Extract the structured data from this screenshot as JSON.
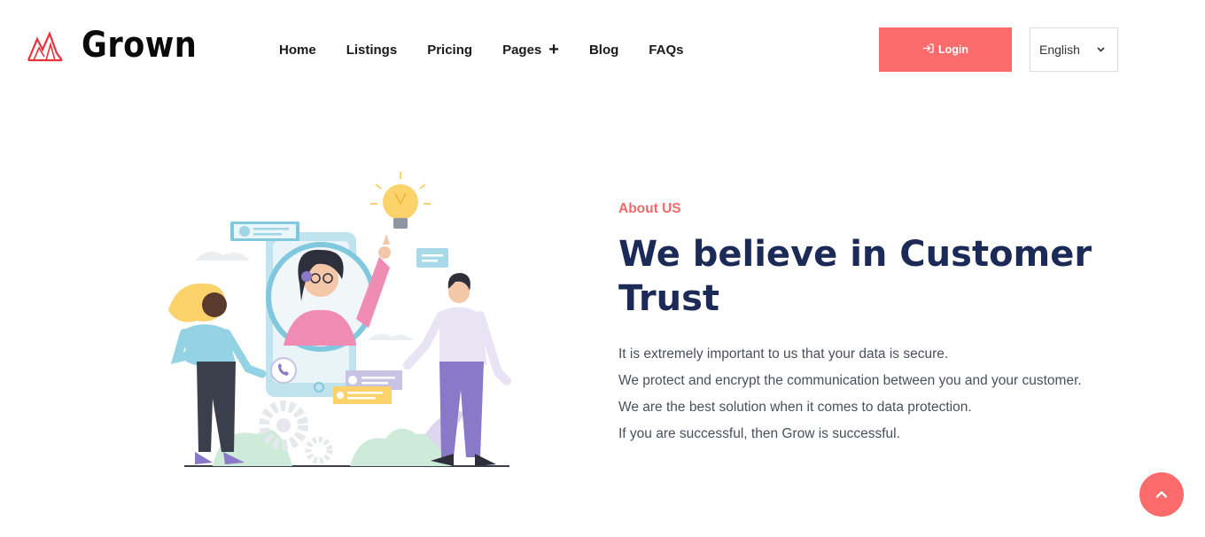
{
  "brand": {
    "name": "Grown"
  },
  "nav": {
    "items": [
      {
        "label": "Home"
      },
      {
        "label": "Listings"
      },
      {
        "label": "Pricing"
      },
      {
        "label": "Pages"
      },
      {
        "label": "Blog"
      },
      {
        "label": "FAQs"
      }
    ]
  },
  "header": {
    "login_label": "Login",
    "language": "English"
  },
  "about": {
    "eyebrow": "About US",
    "title": "We believe in Customer Trust",
    "paragraphs": [
      "It is extremely important to us that your data is secure.",
      "We protect and encrypt the communication between you and your customer.",
      "We are the best solution when it comes to data protection.",
      "If you are successful, then Grow is successful."
    ]
  },
  "colors": {
    "accent": "#fb6b6b",
    "heading": "#1c2a58",
    "eyebrow": "#f26a6a"
  },
  "icons": {
    "logo": "mountain-logo-icon",
    "login": "login-icon",
    "dropdown": "chevron-down-icon",
    "pages_plus": "plus-icon",
    "scroll_top": "chevron-up-icon"
  }
}
